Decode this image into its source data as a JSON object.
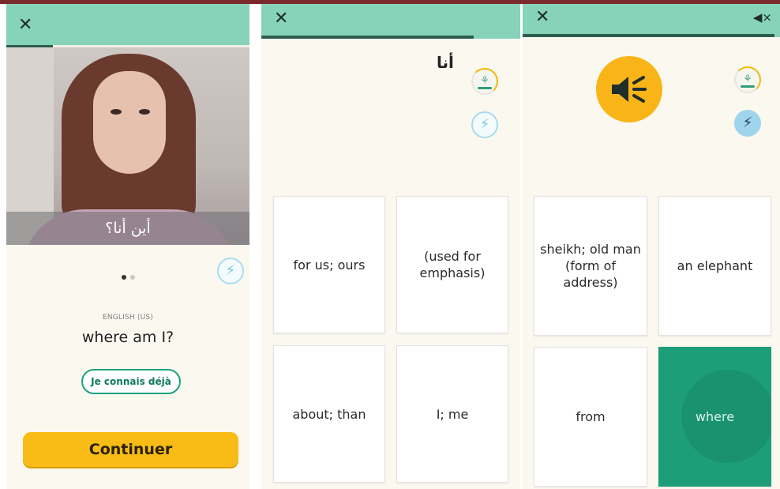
{
  "screens": [
    {
      "close_label": "✕",
      "caption": "أين أنا؟",
      "bolt_icon": "⚡",
      "language_label": "ENGLISH (US)",
      "phrase": "where am I?",
      "know_button": "Je connais déjà",
      "continue_button": "Continuer",
      "pager": {
        "count": 2,
        "active": 1
      },
      "progress": 0.19
    },
    {
      "close_label": "✕",
      "word": "أنا",
      "bolt_icon": "⚡",
      "plant_icon": "⚘",
      "progress": 0.82,
      "cards": [
        "for us; ours",
        "(used for emphasis)",
        "about; than",
        "I; me"
      ]
    },
    {
      "close_label": "✕",
      "mute_label": "◀×",
      "bolt_icon": "⚡",
      "plant_icon": "⚘",
      "progress": 0.98,
      "cards": [
        "sheikh; old man (form of address)",
        "an elephant",
        "from",
        "where"
      ],
      "selected_card": "where"
    }
  ],
  "colors": {
    "header": "#86d3b9",
    "progress": "#2d5d4e",
    "accent_yellow": "#f9bb16",
    "accent_green": "#1d9e78",
    "bolt_blue": "#a9dcef",
    "background": "#fbf8f0"
  }
}
